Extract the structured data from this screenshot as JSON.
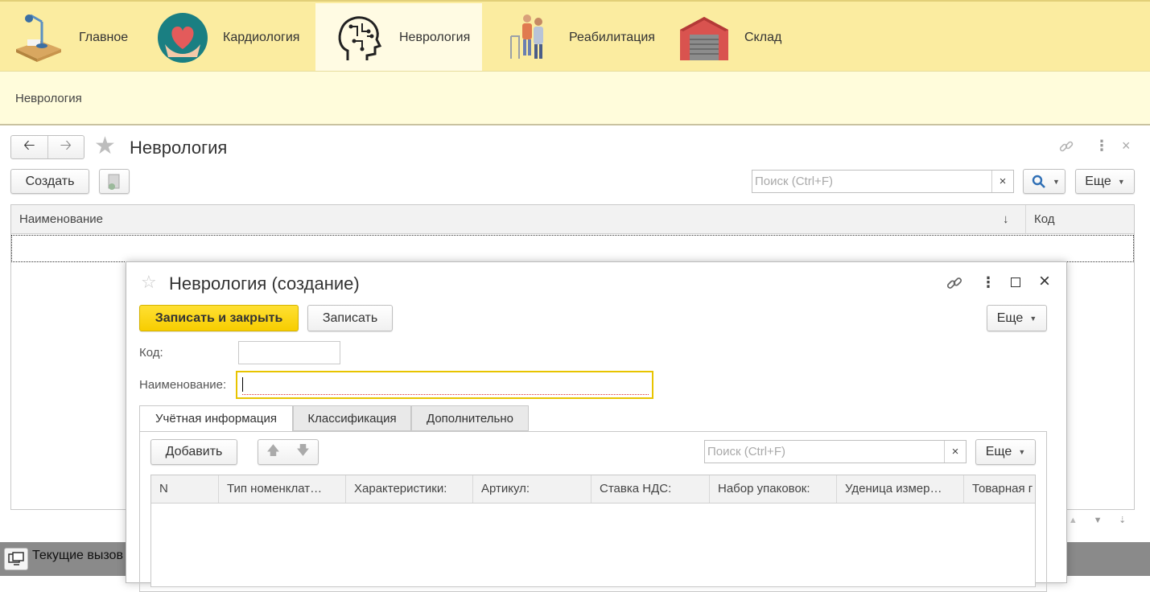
{
  "sections": [
    {
      "label": "Главное",
      "icon": "desk-icon"
    },
    {
      "label": "Кардиология",
      "icon": "heart-hands-icon"
    },
    {
      "label": "Неврология",
      "icon": "brain-head-icon"
    },
    {
      "label": "Реабилитация",
      "icon": "rehab-walker-icon"
    },
    {
      "label": "Склад",
      "icon": "warehouse-icon"
    }
  ],
  "breadcrumb": "Неврология",
  "list_form": {
    "title": "Неврология",
    "create_label": "Создать",
    "search_placeholder": "Поиск (Ctrl+F)",
    "clear_symbol": "×",
    "more_label": "Еще",
    "columns": [
      "Наименование",
      "Код"
    ],
    "sort_indicator": "↓"
  },
  "dialog": {
    "title": "Неврология (создание)",
    "save_close_label": "Записать и закрыть",
    "save_label": "Записать",
    "more_label": "Еще",
    "code_label": "Код:",
    "code_value": "",
    "name_label": "Наименование:",
    "name_value": "",
    "tabs": [
      "Учётная информация",
      "Классификация",
      "Дополнительно"
    ],
    "add_label": "Добавить",
    "search_placeholder": "Поиск (Ctrl+F)",
    "table_more_label": "Еще",
    "columns": [
      "N",
      "Тип номенклат…",
      "Характеристики:",
      "Артикул:",
      "Ставка НДС:",
      "Набор упаковок:",
      "Уденица измер…",
      "Товарная г"
    ]
  },
  "statusbar": {
    "current_calls": "Текущие вызов"
  },
  "colors": {
    "topbar": "#fbeca0",
    "subbar": "#fffcdb",
    "primary": "#f7cd00",
    "focus_border": "#e8c400"
  }
}
